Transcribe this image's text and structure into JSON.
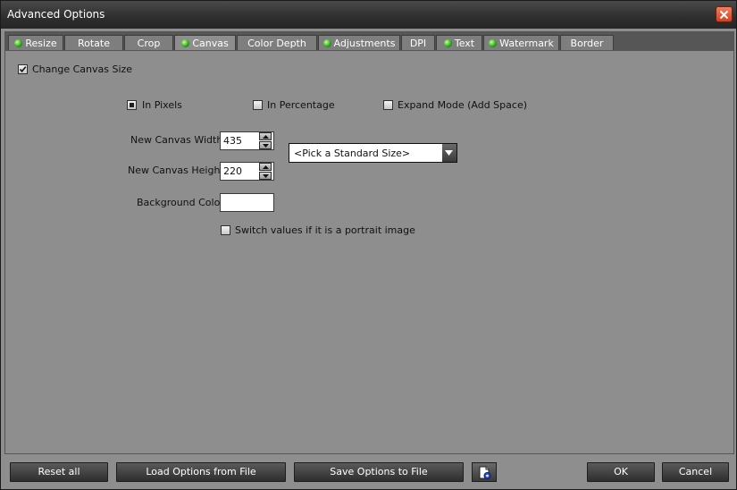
{
  "window": {
    "title": "Advanced Options"
  },
  "tabs": [
    {
      "label": "Resize",
      "led": true,
      "active": false
    },
    {
      "label": "Rotate",
      "led": false,
      "active": false
    },
    {
      "label": "Crop",
      "led": false,
      "active": false
    },
    {
      "label": "Canvas",
      "led": true,
      "active": true
    },
    {
      "label": "Color Depth",
      "led": false,
      "active": false
    },
    {
      "label": "Adjustments",
      "led": true,
      "active": false
    },
    {
      "label": "DPI",
      "led": false,
      "active": false
    },
    {
      "label": "Text",
      "led": true,
      "active": false
    },
    {
      "label": "Watermark",
      "led": true,
      "active": false
    },
    {
      "label": "Border",
      "led": false,
      "active": false
    }
  ],
  "canvas": {
    "change_canvas_size_label": "Change Canvas Size",
    "change_canvas_size_checked": true,
    "mode_options": [
      {
        "label": "In Pixels",
        "selected": true
      },
      {
        "label": "In Percentage",
        "selected": false
      },
      {
        "label": "Expand Mode (Add Space)",
        "selected": false
      }
    ],
    "width_label": "New Canvas Width:",
    "width_value": "435",
    "height_label": "New Canvas Height:",
    "height_value": "220",
    "standard_size_selected": "<Pick a Standard Size>",
    "background_color_label": "Background Color:",
    "background_color": "#ffffff",
    "switch_portrait_label": "Switch values if it is a portrait image",
    "switch_portrait_checked": false
  },
  "buttons": {
    "reset_all": "Reset all",
    "load_options": "Load Options from File",
    "save_options": "Save Options to File",
    "ok": "OK",
    "cancel": "Cancel"
  },
  "icons": {
    "close": "close-icon",
    "led": "status-led-icon",
    "spin_up": "arrow-up-icon",
    "spin_down": "arrow-down-icon",
    "dropdown": "chevron-down-icon",
    "options_file": "document-gear-icon"
  },
  "colors": {
    "panel_bg": "#8e8e8e",
    "titlebar_bg": "#2e2e2e",
    "close_button": "#e05a36",
    "led_green": "#2fae1c"
  }
}
